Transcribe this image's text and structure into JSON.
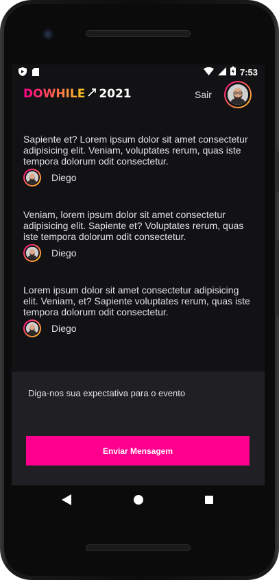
{
  "status_bar": {
    "time": "7:53",
    "left_icons": [
      "shield-icon",
      "sim-card-icon"
    ],
    "right_icons": [
      "wifi-icon",
      "signal-icon",
      "battery-charging-icon"
    ]
  },
  "header": {
    "logo_text": "DOWHILE",
    "logo_year": "2021",
    "signout_label": "Sair",
    "colors": {
      "pink": "#ff008e",
      "yellow": "#ffcd1e"
    }
  },
  "messages": [
    {
      "text": "Sapiente et? Lorem ipsum dolor sit amet consectetur adipisicing elit. Veniam, voluptates rerum, quas iste tempora dolorum odit consectetur.",
      "user": "Diego"
    },
    {
      "text": "Veniam, lorem ipsum dolor sit amet consectetur adipisicing elit. Sapiente et? Voluptates rerum, quas iste tempora dolorum odit consectetur.",
      "user": "Diego"
    },
    {
      "text": "Lorem ipsum dolor sit amet consectetur adipisicing elit. Veniam, et? Sapiente voluptates rerum, quas iste tempora dolorum odit consectetur.",
      "user": "Diego"
    }
  ],
  "compose": {
    "placeholder": "Diga-nos sua expectativa para o evento",
    "value": "",
    "send_label": "Enviar Mensagem",
    "button_color": "#ff008e"
  },
  "nav": {
    "icons": [
      "back-icon",
      "home-icon",
      "recents-icon"
    ]
  }
}
